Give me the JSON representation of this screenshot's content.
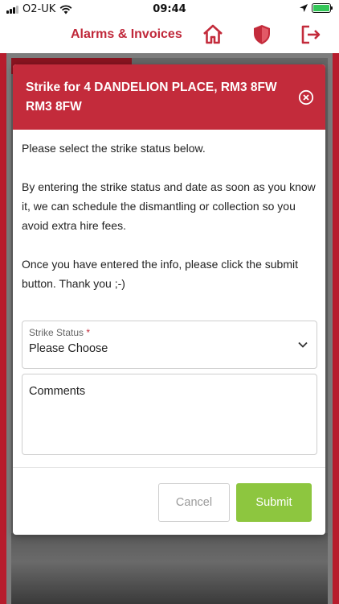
{
  "status_bar": {
    "carrier": "O2-UK",
    "time": "09:44",
    "icons": [
      "cellular-signal-icon",
      "wifi-icon",
      "location-icon",
      "battery-charging-icon"
    ]
  },
  "header": {
    "title": "Alarms & Invoices",
    "icons": [
      "home-icon",
      "shield-icon",
      "logout-icon"
    ],
    "accent_color": "#c32b3b"
  },
  "modal": {
    "title": "Strike for 4 DANDELION PLACE, RM3 8FW RM3 8FW",
    "paragraphs": [
      "Please select the strike status below.",
      "By entering the strike status and date as soon as you know it, we can schedule the dismantling or collection so you avoid extra hire fees.",
      "Once you have entered the info, please click the submit button. Thank you ;-)"
    ],
    "strike_status": {
      "label": "Strike Status",
      "required_mark": "*",
      "value": "Please Choose"
    },
    "comments": {
      "label": "Comments",
      "value": ""
    },
    "buttons": {
      "cancel": "Cancel",
      "submit": "Submit"
    },
    "colors": {
      "header": "#c32b3b",
      "submit": "#8dc63f"
    }
  }
}
